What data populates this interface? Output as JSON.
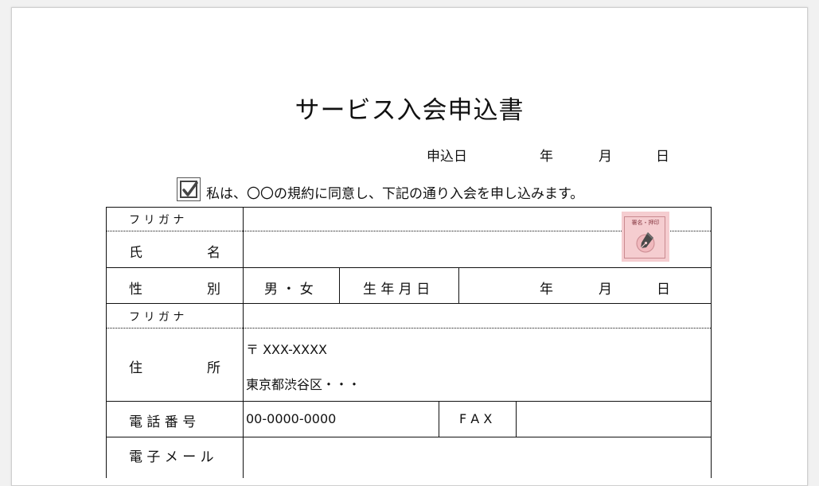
{
  "document": {
    "title": "サービス入会申込書",
    "application_date": {
      "label": "申込日",
      "year": "年",
      "month": "月",
      "day": "日"
    },
    "agreement": {
      "checked": true,
      "text": "私は、〇〇の規約に同意し、下記の通り入会を申し込みます。"
    },
    "stamp_label": "署名・押印",
    "stamp_icon": "pen-nib-icon",
    "rows": {
      "name_furigana": "フ リ ガ ナ",
      "name_label_1": "氏",
      "name_label_2": "名",
      "gender_label_1": "性",
      "gender_label_2": "別",
      "gender_options": "男 ・ 女",
      "birthdate_label": "生 年 月 日",
      "birth_year": "年",
      "birth_month": "月",
      "birth_day": "日",
      "address_furigana": "フ リ ガ ナ",
      "address_label_1": "住",
      "address_label_2": "所",
      "postal_code": "〒 XXX-XXXX",
      "address_value": "東京都渋谷区・・・",
      "phone_label": "電 話 番 号",
      "phone_value": "00-0000-0000",
      "fax_label": "F A X",
      "fax_value": "",
      "email_label": "電 子 メ ー ル",
      "email_value": ""
    }
  }
}
